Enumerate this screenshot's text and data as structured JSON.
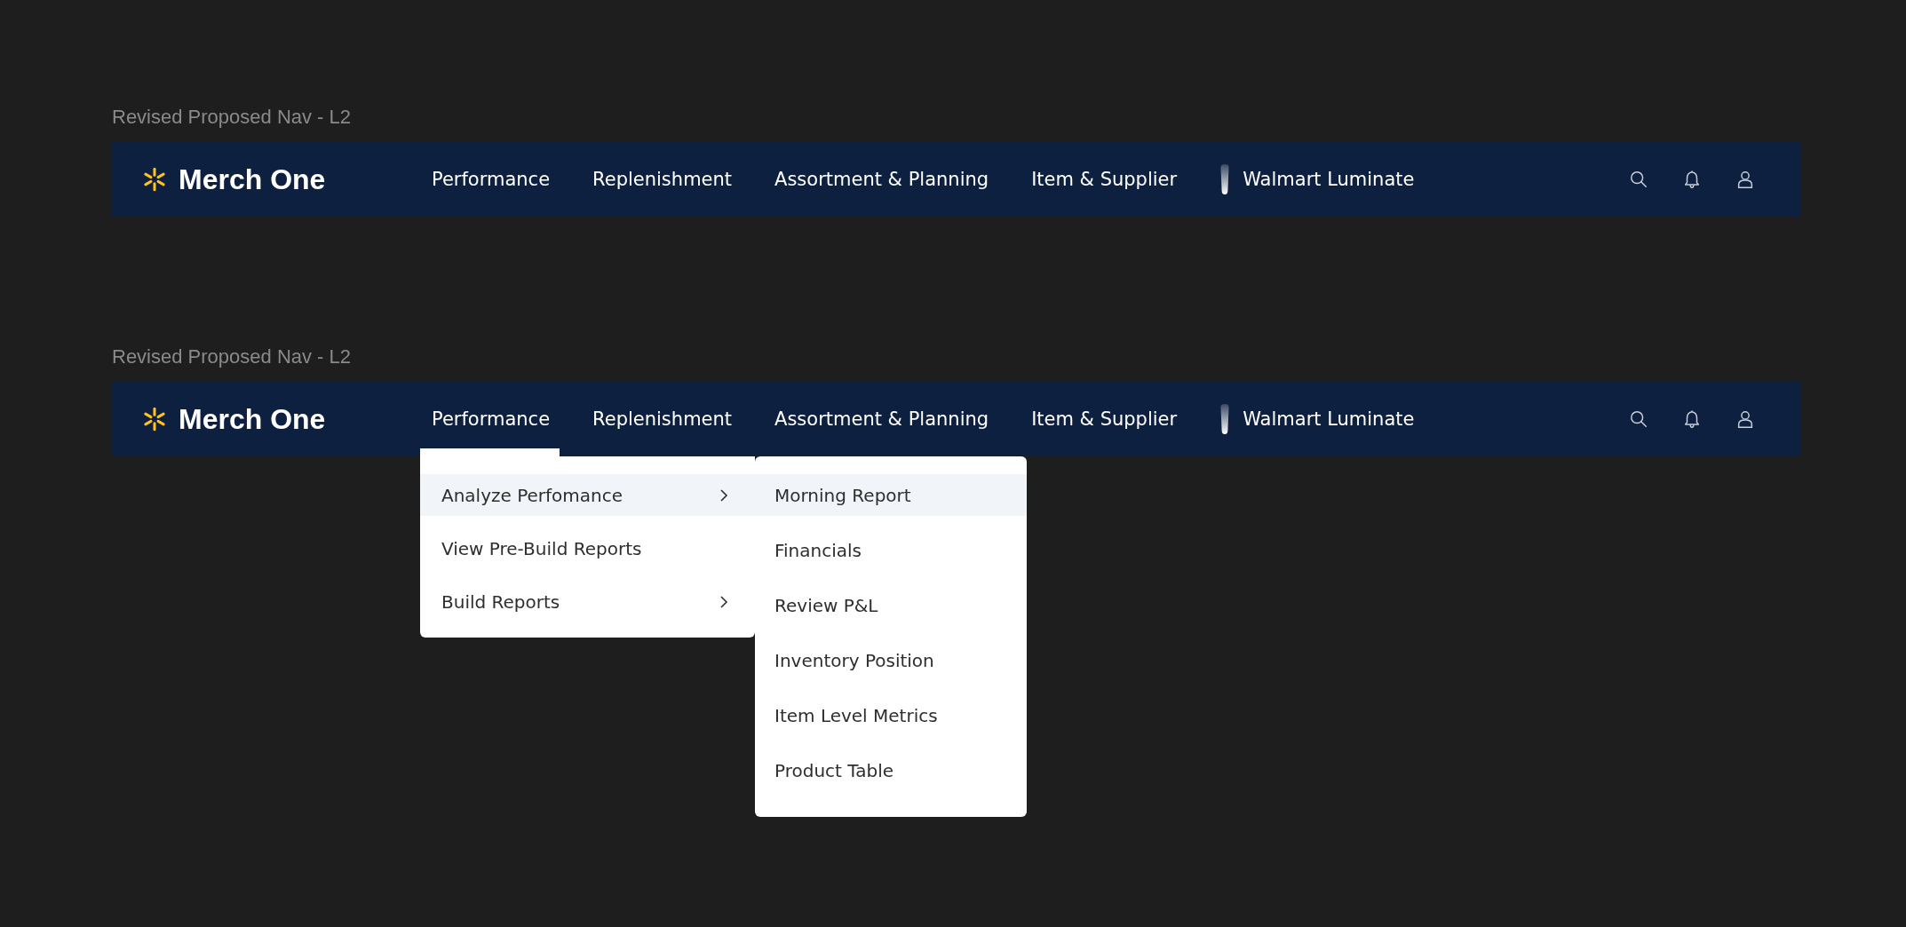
{
  "frames": [
    {
      "label": "Revised Proposed Nav - L2",
      "nav": {
        "logo_text": "Merch One",
        "items": [
          "Performance",
          "Replenishment",
          "Assortment & Planning",
          "Item & Supplier"
        ],
        "luminate": "Walmart Luminate"
      }
    },
    {
      "label": "Revised Proposed Nav - L2",
      "nav": {
        "logo_text": "Merch One",
        "items": [
          "Performance",
          "Replenishment",
          "Assortment & Planning",
          "Item & Supplier"
        ],
        "luminate": "Walmart Luminate"
      },
      "dropdown": {
        "items": [
          {
            "label": "Analyze Perfomance",
            "selected": true,
            "has_submenu": true
          },
          {
            "label": "View Pre-Build Reports",
            "selected": false,
            "has_submenu": false
          },
          {
            "label": "Build Reports",
            "selected": false,
            "has_submenu": true
          }
        ],
        "submenu": {
          "items": [
            {
              "label": "Morning Report",
              "selected": true
            },
            {
              "label": "Financials",
              "selected": false
            },
            {
              "label": "Review P&L",
              "selected": false
            },
            {
              "label": "Inventory Position",
              "selected": false
            },
            {
              "label": "Item Level Metrics",
              "selected": false
            },
            {
              "label": "Product Table",
              "selected": false
            }
          ]
        }
      }
    }
  ]
}
